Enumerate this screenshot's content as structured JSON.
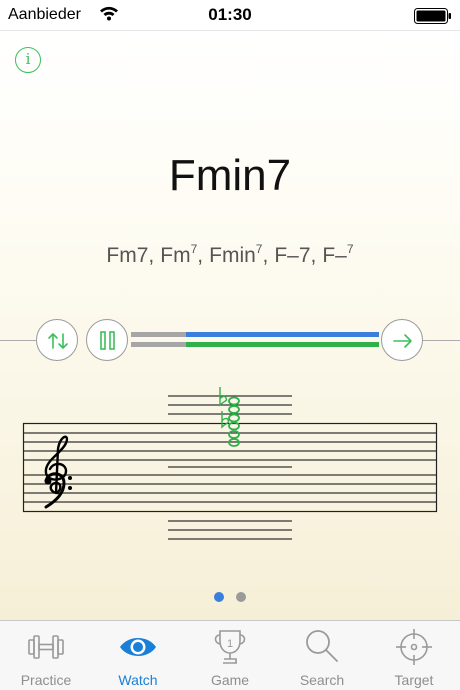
{
  "status_bar": {
    "carrier": "Aanbieder",
    "time": "01:30"
  },
  "chord": {
    "name": "Fmin7",
    "alternatives": [
      {
        "base": "Fm7,",
        "sup": ""
      },
      {
        "base": "Fm",
        "sup": "7",
        "after": ","
      },
      {
        "base": "Fmin",
        "sup": "7",
        "after": ","
      },
      {
        "base": "F–7,",
        "sup": ""
      },
      {
        "base": "F–",
        "sup": "7"
      }
    ]
  },
  "info_icon": "info-icon",
  "icons": {
    "swap": "swap-arrows-icon",
    "pause": "pause-icon",
    "next": "arrow-right-icon"
  },
  "progress": {
    "played_fraction": 0.22
  },
  "pager": {
    "pages": 2,
    "current": 0
  },
  "tabs": [
    {
      "label": "Practice",
      "icon": "dumbbell-icon",
      "active": false
    },
    {
      "label": "Watch",
      "icon": "eye-icon",
      "active": true
    },
    {
      "label": "Game",
      "icon": "trophy-icon",
      "active": false
    },
    {
      "label": "Search",
      "icon": "magnifier-icon",
      "active": false
    },
    {
      "label": "Target",
      "icon": "crosshair-icon",
      "active": false
    }
  ],
  "colors": {
    "accent_green": "#3cbf5a",
    "accent_blue": "#3a7fdc",
    "tab_active": "#1a7fd6",
    "tab_inactive": "#8e8e8e"
  }
}
